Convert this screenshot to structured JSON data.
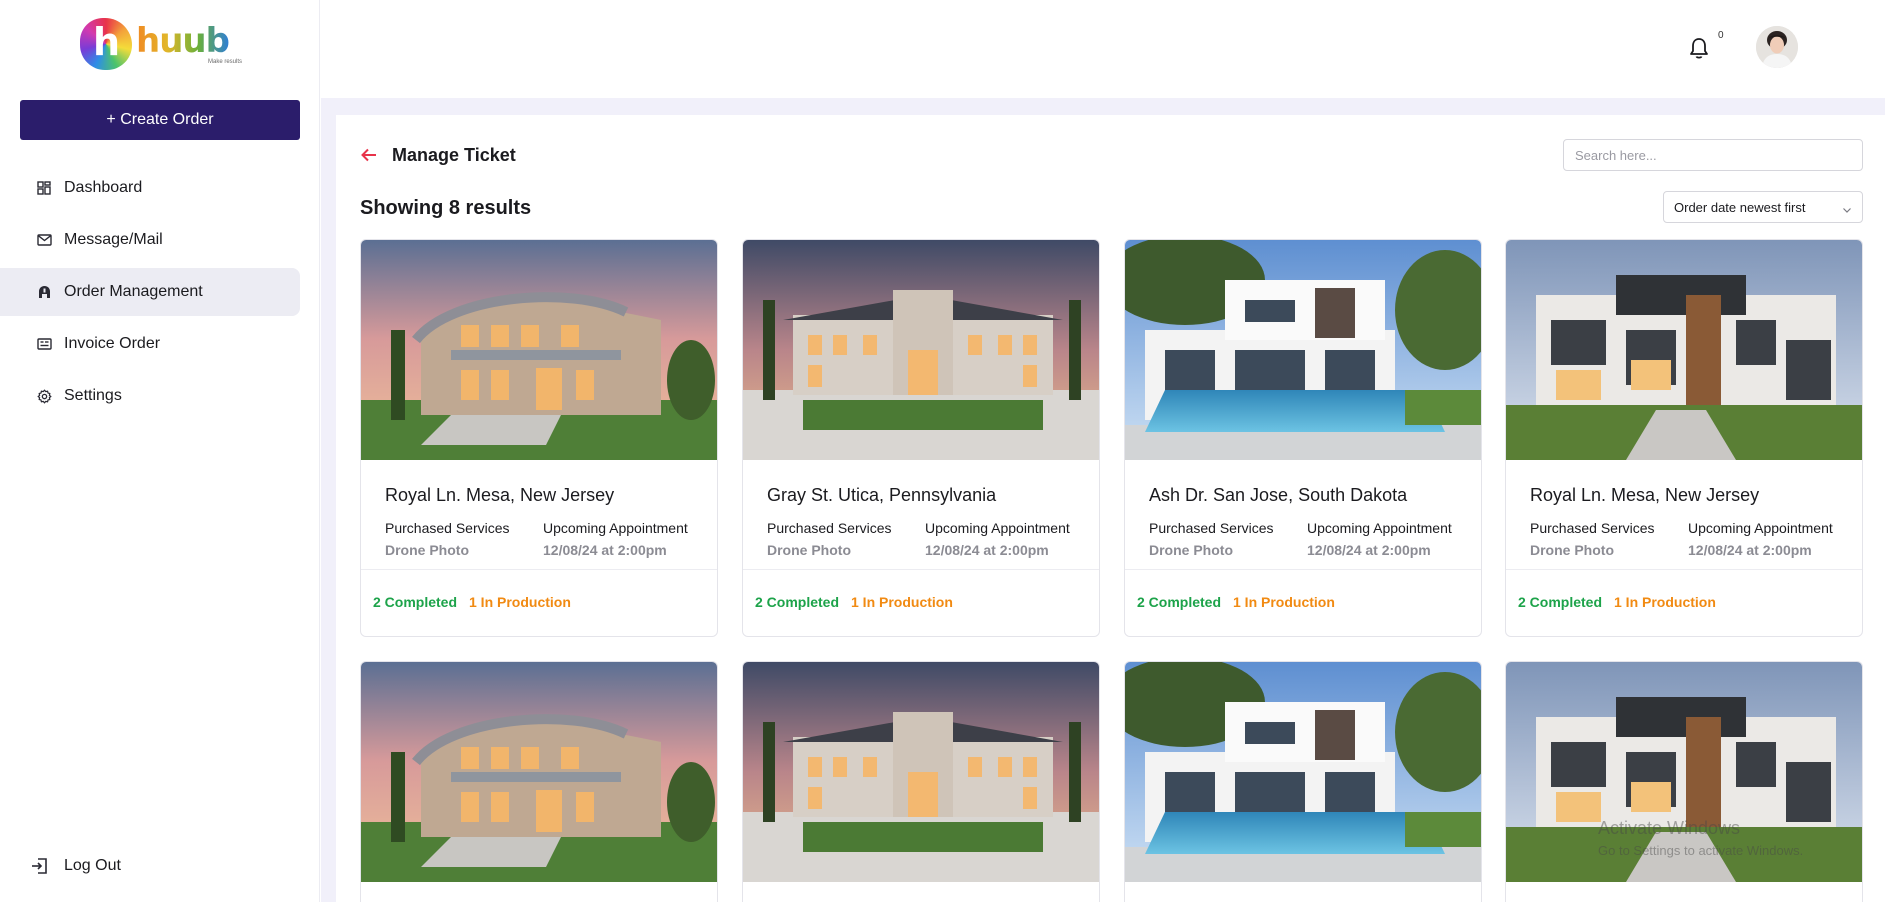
{
  "brand": {
    "logo_letter": "h",
    "logo_word": "huub",
    "logo_tagline": "Make results"
  },
  "sidebar": {
    "create_label": "+ Create Order",
    "items": [
      {
        "label": "Dashboard",
        "icon": "dashboard-icon"
      },
      {
        "label": "Message/Mail",
        "icon": "mail-icon"
      },
      {
        "label": "Order Management",
        "icon": "order-icon",
        "active": true
      },
      {
        "label": "Invoice Order",
        "icon": "invoice-icon"
      },
      {
        "label": "Settings",
        "icon": "gear-icon"
      }
    ],
    "logout_label": "Log Out"
  },
  "topbar": {
    "notification_count": "0"
  },
  "page": {
    "title": "Manage Ticket",
    "search_placeholder": "Search here...",
    "results_text": "Showing 8 results",
    "sort_label": "Order date newest first"
  },
  "colors": {
    "primary": "#2b1d6b",
    "completed": "#1da34a",
    "production": "#f18a12",
    "accent_back": "#e8334a"
  },
  "cards": [
    {
      "title": "Royal Ln. Mesa, New Jersey",
      "services_label": "Purchased Services",
      "services_value": "Drone Photo",
      "appt_label": "Upcoming Appointment",
      "appt_value": "12/08/24 at 2:00pm",
      "completed": "2 Completed",
      "production": "1 In Production",
      "image": "sunset-house"
    },
    {
      "title": "Gray St. Utica, Pennsylvania",
      "services_label": "Purchased Services",
      "services_value": "Drone Photo",
      "appt_label": "Upcoming Appointment",
      "appt_value": "12/08/24 at 2:00pm",
      "completed": "2 Completed",
      "production": "1 In Production",
      "image": "mansion-dusk"
    },
    {
      "title": "Ash Dr. San Jose, South Dakota",
      "services_label": "Purchased Services",
      "services_value": "Drone Photo",
      "appt_label": "Upcoming Appointment",
      "appt_value": "12/08/24 at 2:00pm",
      "completed": "2 Completed",
      "production": "1 In Production",
      "image": "white-pool-house"
    },
    {
      "title": "Royal Ln. Mesa, New Jersey",
      "services_label": "Purchased Services",
      "services_value": "Drone Photo",
      "appt_label": "Upcoming Appointment",
      "appt_value": "12/08/24 at 2:00pm",
      "completed": "2 Completed",
      "production": "1 In Production",
      "image": "modern-dark-house"
    },
    {
      "image": "sunset-house"
    },
    {
      "image": "mansion-dusk"
    },
    {
      "image": "white-pool-house"
    },
    {
      "image": "modern-dark-house"
    }
  ],
  "watermark": {
    "line1": "Activate Windows",
    "line2": "Go to Settings to activate Windows."
  }
}
